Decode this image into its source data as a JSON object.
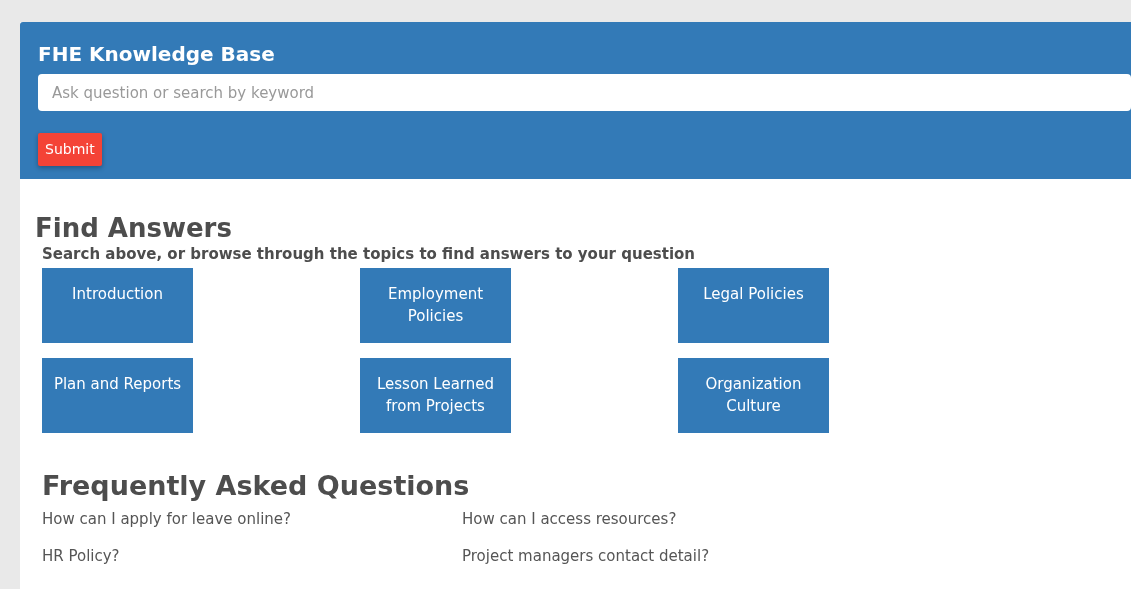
{
  "header": {
    "title": "FHE Knowledge Base",
    "search": {
      "placeholder": "Ask question or search by keyword"
    },
    "submit": "Submit"
  },
  "find_answers": {
    "heading": "Find Answers",
    "subtitle": "Search above, or browse through the topics to find answers to your question",
    "topics": [
      "Introduction",
      "Employment Policies",
      "Legal Policies",
      "Plan and Reports",
      "Lesson Learned from Projects",
      "Organization Culture"
    ]
  },
  "faq": {
    "heading": "Frequently Asked Questions",
    "questions": [
      "How can I apply for leave online?",
      "How can I access resources?",
      "HR Policy?",
      "Project managers contact detail?"
    ]
  }
}
